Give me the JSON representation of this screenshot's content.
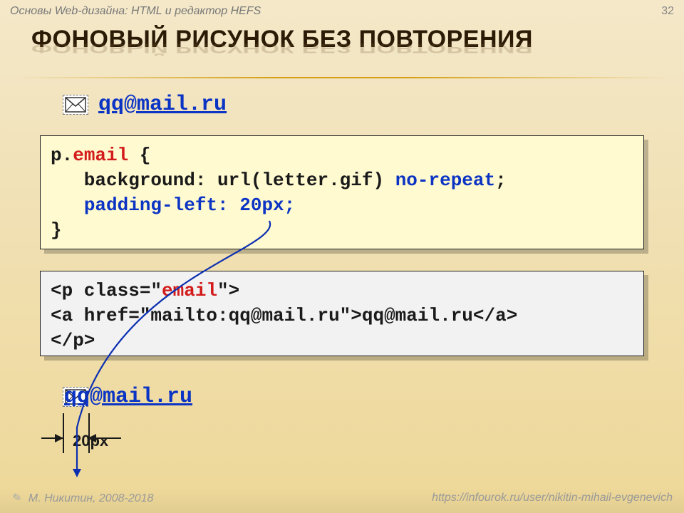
{
  "header": {
    "subtitle": "Основы Web-дизайна: HTML и редактор HEFS",
    "page_number": "32"
  },
  "title": "ФОНОВЫЙ РИСУНОК БЕЗ ПОВТОРЕНИЯ",
  "example": {
    "email_text": "qq@mail.ru",
    "padding_label": "20px"
  },
  "code_css": {
    "line1_a": "p.",
    "line1_b": "email",
    "line1_c": " {",
    "line2_a": "   background: url(letter.gif) ",
    "line2_b": "no-repeat",
    "line2_c": ";",
    "line3_a": "   ",
    "line3_b": "padding-left: 20px;",
    "line4": "}"
  },
  "code_html": {
    "line1_a": "<p class=\"",
    "line1_b": "email",
    "line1_c": "\">",
    "line2": "<a href=\"mailto:qq@mail.ru\">qq@mail.ru</a>",
    "line3": "</p>"
  },
  "footer": {
    "author": "М. Никитин, 2008-2018",
    "url": "https://infourok.ru/user/nikitin-mihail-evgenevich"
  }
}
